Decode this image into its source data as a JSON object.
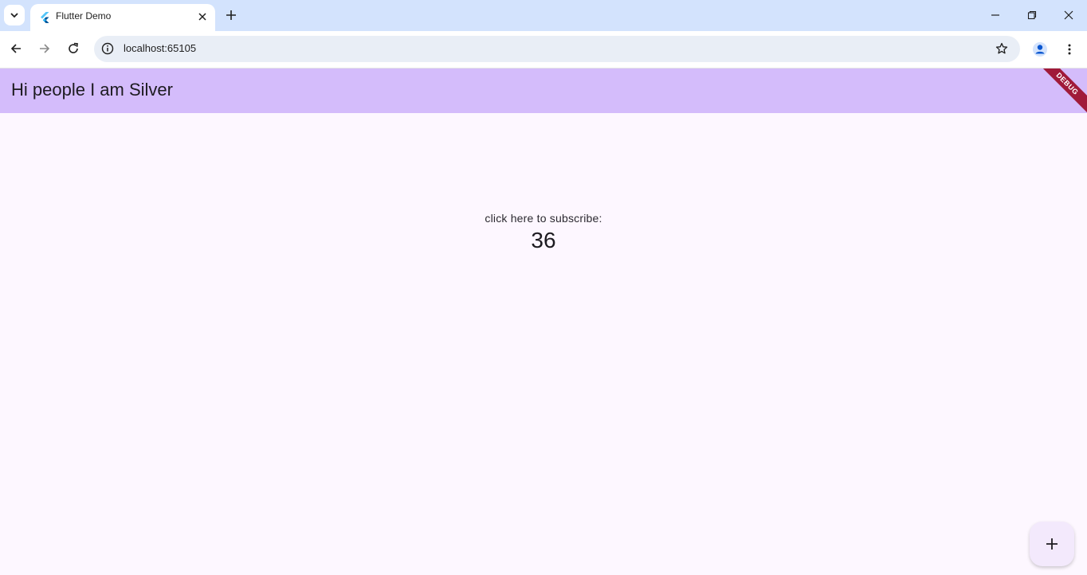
{
  "browser": {
    "tab": {
      "title": "Flutter Demo"
    },
    "address_bar": {
      "url": "localhost:65105"
    }
  },
  "app": {
    "appbar_title": "Hi people I am Silver",
    "debug_banner": "DEBUG",
    "subscribe_label": "click here to subscribe:",
    "counter_value": "36",
    "fab_icon": "add-icon"
  },
  "colors": {
    "tabstrip_bg": "#d3e3fd",
    "appbar_bg": "#d4bcfb",
    "page_bg": "#fdf7ff",
    "debug_banner": "#a01a3a",
    "fab_bg": "#f3e9fc"
  }
}
